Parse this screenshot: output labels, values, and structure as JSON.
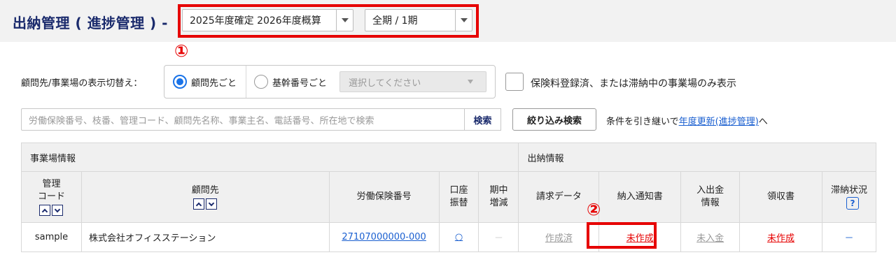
{
  "header": {
    "title": "出納管理 ( 進捗管理 ) -",
    "fiscal_select": "2025年度確定 2026年度概算",
    "period_select": "全期 / 1期"
  },
  "markers": {
    "one": "①",
    "two": "②"
  },
  "display_toggle": {
    "label": "顧問先/事業場の表示切替え：",
    "option_client": "顧問先ごと",
    "option_base": "基幹番号ごと",
    "select_placeholder": "選択してください"
  },
  "filter_checkbox": {
    "label": "保険料登録済、または滞納中の事業場のみ表示"
  },
  "search": {
    "placeholder": "労働保険番号、枝番、管理コード、顧問先名称、事業主名、電話番号、所在地で検索",
    "search_button": "検索",
    "filter_button": "絞り込み検索",
    "carry_prefix": "条件を引き継いで",
    "carry_link": "年度更新(進捗管理)",
    "carry_suffix": "へ"
  },
  "table": {
    "group_office": "事業場情報",
    "group_cash": "出納情報",
    "headers": {
      "code_line1": "管理",
      "code_line2": "コード",
      "client": "顧問先",
      "labor_no": "労働保険番号",
      "account_line1": "口座",
      "account_line2": "振替",
      "mid_line1": "期中",
      "mid_line2": "増減",
      "billing": "請求データ",
      "notice": "納入通知書",
      "deposit_line1": "入出金",
      "deposit_line2": "情報",
      "receipt": "領収書",
      "arrears": "滞納状況",
      "help": "?"
    },
    "rows": [
      {
        "code": "sample",
        "client": "株式会社オフィスステーション",
        "labor_no": "27107000000-000",
        "account": "○",
        "mid": "－",
        "billing": "作成済",
        "notice": "未作成",
        "deposit": "未入金",
        "receipt": "未作成",
        "arrears": "－"
      }
    ]
  },
  "colors": {
    "accent_red": "#e60000",
    "title_navy": "#1a2a6c",
    "link_blue": "#1a5fd0"
  }
}
